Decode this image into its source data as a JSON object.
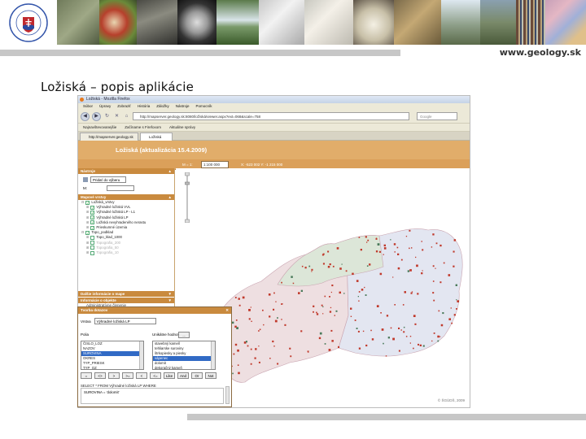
{
  "slide": {
    "site_url": "www.geology.sk",
    "title": "Ložiská – popis aplikácie"
  },
  "browser": {
    "window_title": "Ložiská - Mozilla Firefox",
    "menu": [
      "Súbor",
      "Úpravy",
      "Zobraziť",
      "História",
      "Záložky",
      "Nástroje",
      "Pomocník"
    ],
    "url": "http://mapserver.geology.sk:8080/ložiská/viewer.aspx?ext=068&scale=758",
    "search_placeholder": "Google",
    "bookmarks": [
      "Najnavštevovanejšie",
      "Začíname s Firefoxom",
      "Aktuálne správy"
    ],
    "tabs": [
      "http://mapserver.geology.sk",
      "Ložiská"
    ]
  },
  "app": {
    "title": "Ložiská (aktualizácia 15.4.2009)",
    "scale_label": "M = 1:",
    "scale_value": "1:100 000",
    "coords": "X: -523 002   Y: -1 215 000",
    "panels": {
      "tools": "Nástroje",
      "layers": "Mapové vrstvy",
      "legend": "Dalšie informácie o mape",
      "info": "Informácie o objekte",
      "query": "Tvorba dotazov"
    },
    "tool_select": "Pridať do výberu",
    "scale_row_label": "M:",
    "layers": [
      {
        "label": "Ložiská_vrstvy",
        "level": 1,
        "checked": true,
        "gray": false
      },
      {
        "label": "Výhradné ložiská VVL",
        "level": 2,
        "checked": true,
        "gray": false
      },
      {
        "label": "Výhradné ložiská LP - L1",
        "level": 2,
        "checked": true,
        "gray": false
      },
      {
        "label": "Výhradné ložiská LP",
        "level": 2,
        "checked": true,
        "gray": false
      },
      {
        "label": "Ložiská nevyhradeného nerastu",
        "level": 2,
        "checked": true,
        "gray": false
      },
      {
        "label": "Prieskumné územia",
        "level": 2,
        "checked": true,
        "gray": false
      },
      {
        "label": "Topo_podklad",
        "level": 1,
        "checked": true,
        "gray": false
      },
      {
        "label": "Topo_klad_1000",
        "level": 2,
        "checked": false,
        "gray": false
      },
      {
        "label": "Topografia_200",
        "level": 2,
        "checked": false,
        "gray": true
      },
      {
        "label": "Topografia_50",
        "level": 2,
        "checked": false,
        "gray": true
      },
      {
        "label": "Topografia_10",
        "level": 2,
        "checked": false,
        "gray": true
      }
    ],
    "legend_items": [
      "Administratívne členenie",
      "Zobrazenie"
    ],
    "copyright": "© ŠGÚDŠ, 2009"
  },
  "dialog": {
    "layer_label": "Vrstva",
    "layer_value": "Výhradné ložiská LP",
    "fields_label": "Polia",
    "values_label": "Unikátne hodnoty",
    "values_button": "...",
    "fields": [
      "ČISLO_LOZ",
      "NAZOV",
      "SUROVINA",
      "OKRES",
      "TYP_PRIESK",
      "TYP_OZ"
    ],
    "selected_field_index": 2,
    "values": [
      "stavebný kameň",
      "tehliarske suroviny",
      "štrkopiesky a piesky",
      "vápenec",
      "dolomit",
      "dekoračný kameň"
    ],
    "selected_value_index": 3,
    "operators": [
      "=",
      "<>",
      ">",
      ">=",
      "<",
      "<=",
      "Like",
      "And",
      "Or",
      "Not"
    ],
    "sql_prefix": "SELECT * FROM Výhradné ložiská LP WHERE",
    "sql_query": "SUROVINA = 'dolomit'"
  },
  "colors": {
    "app_title_bg": "#e1ad6a",
    "panel_header": "#c98a3e",
    "map_region_1": "#eedfe1",
    "map_region_2": "#e3e6f1",
    "map_region_3": "#dce6d8",
    "deposit_point": "#c0392b"
  }
}
